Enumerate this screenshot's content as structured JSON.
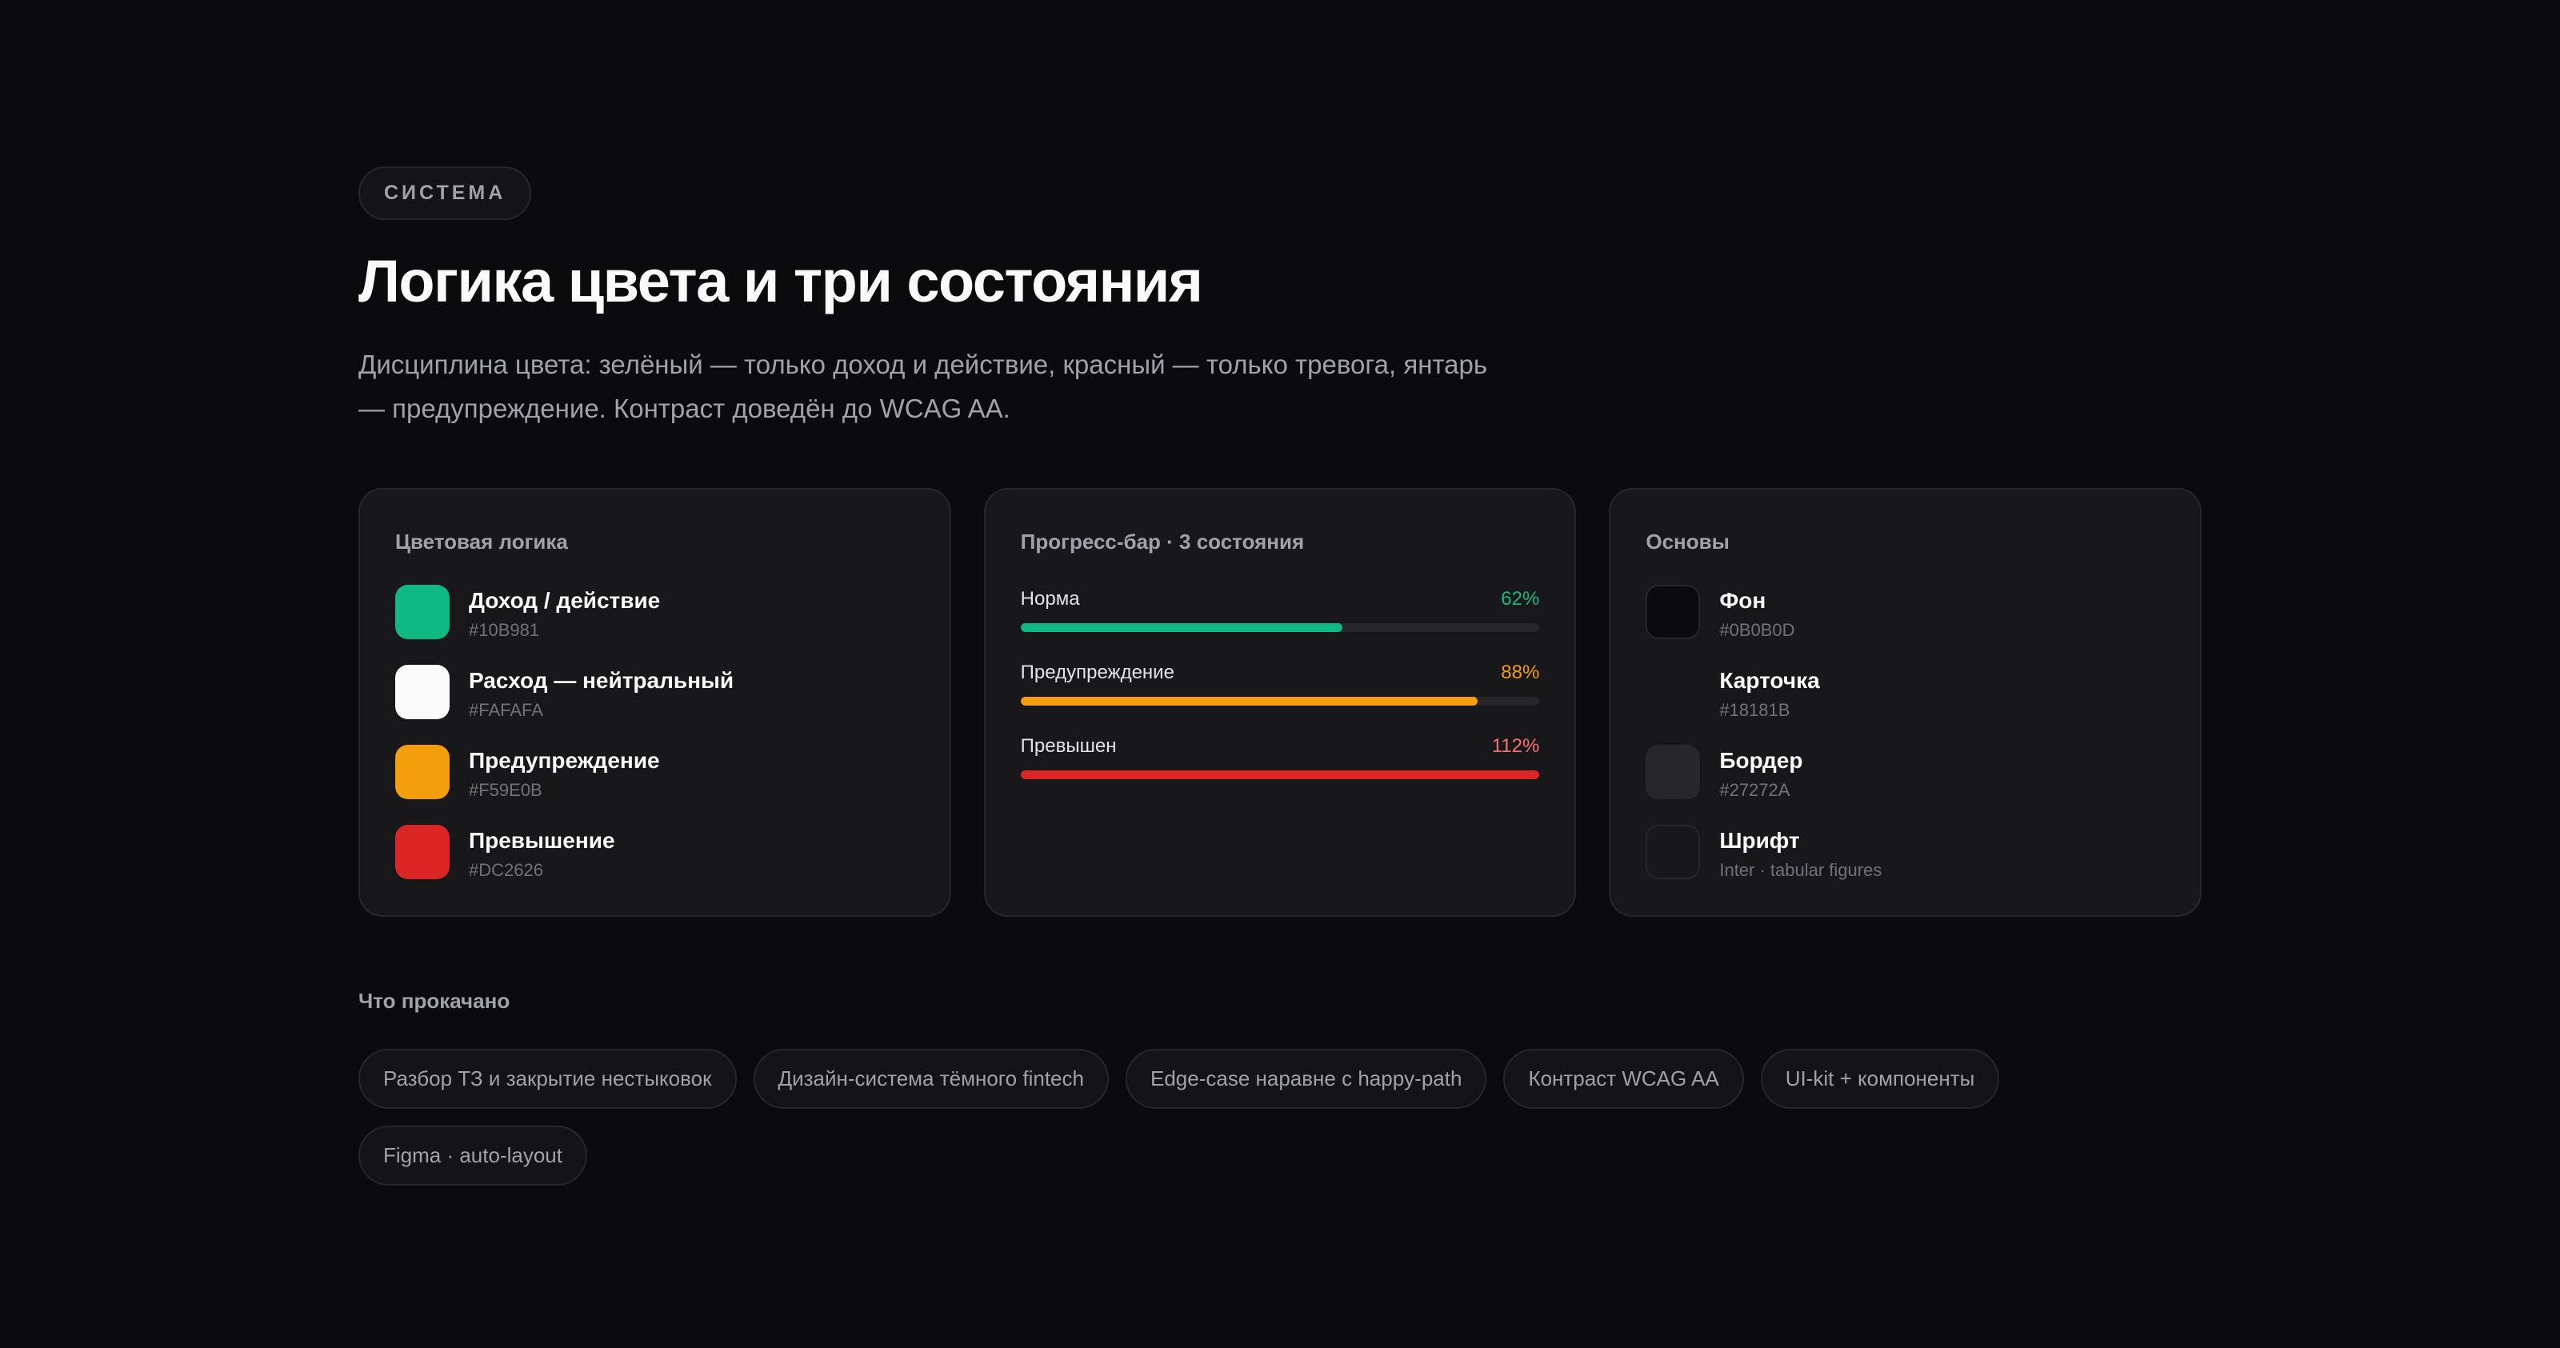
{
  "header": {
    "badge": "СИСТЕМА",
    "title": "Логика цвета и три состояния",
    "subtitle": "Дисциплина цвета: зелёный — только доход и действие, красный — только тревога, янтарь — предупреждение. Контраст доведён до WCAG AA."
  },
  "color_card": {
    "title": "Цветовая логика",
    "items": [
      {
        "name": "Доход / действие",
        "hex": "#10B981",
        "color": "#10B981"
      },
      {
        "name": "Расход — нейтральный",
        "hex": "#FAFAFA",
        "color": "#FAFAFA"
      },
      {
        "name": "Предупреждение",
        "hex": "#F59E0B",
        "color": "#F59E0B"
      },
      {
        "name": "Превышение",
        "hex": "#DC2626",
        "color": "#DC2626"
      }
    ]
  },
  "progress_card": {
    "title": "Прогресс-бар · 3 состояния",
    "bars": [
      {
        "label": "Норма",
        "percent_label": "62%",
        "fill_fraction": 0.62,
        "color": "#10B981"
      },
      {
        "label": "Предупреждение",
        "percent_label": "88%",
        "fill_fraction": 0.88,
        "color": "#F59E0B"
      },
      {
        "label": "Превышен",
        "percent_label": "112%",
        "fill_fraction": 1.0,
        "color": "#DC2626",
        "text_color": "#F87171"
      }
    ]
  },
  "base_card": {
    "title": "Основы",
    "items": [
      {
        "name": "Фон",
        "hex": "#0B0B0D",
        "color": "#0B0B0D"
      },
      {
        "name": "Карточка",
        "hex": "#18181B",
        "color": "#18181B"
      },
      {
        "name": "Бордер",
        "hex": "#27272A",
        "color": "#27272A"
      },
      {
        "name": "Шрифт",
        "hex": "Inter · tabular figures",
        "color": "#18181B"
      }
    ]
  },
  "skills": {
    "label": "Что прокачано",
    "tags": [
      "Разбор ТЗ и закрытие нестыковок",
      "Дизайн-система тёмного fintech",
      "Edge-case наравне с happy-path",
      "Контраст WCAG AA",
      "UI-kit + компоненты",
      "Figma · auto-layout"
    ]
  }
}
